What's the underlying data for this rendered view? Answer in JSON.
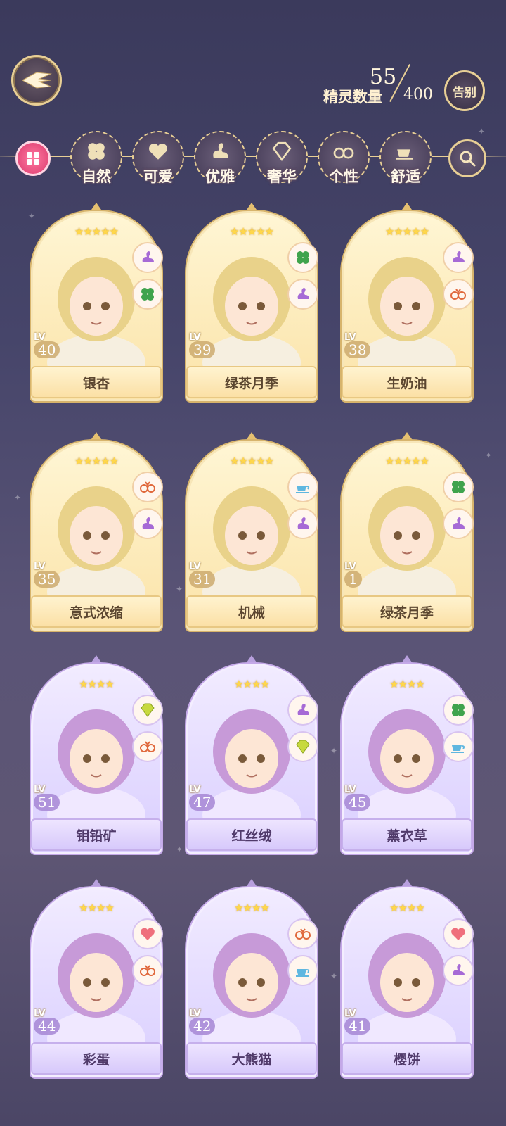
{
  "header": {
    "count_label": "精灵数量",
    "count_current": "55",
    "count_max": "400",
    "farewell_label": "告别"
  },
  "filters": [
    {
      "label": "自然",
      "icon": "clover-icon"
    },
    {
      "label": "可爱",
      "icon": "heart-icon"
    },
    {
      "label": "优雅",
      "icon": "swan-icon"
    },
    {
      "label": "奢华",
      "icon": "diamond-icon"
    },
    {
      "label": "个性",
      "icon": "glasses-icon"
    },
    {
      "label": "舒适",
      "icon": "teacup-icon"
    }
  ],
  "cards": [
    {
      "name": "银杏",
      "level": "40",
      "stars": "★★★★★",
      "rarity": "gold",
      "tags": [
        "swan-icon",
        "clover-icon"
      ]
    },
    {
      "name": "绿茶月季",
      "level": "39",
      "stars": "★★★★★",
      "rarity": "gold",
      "tags": [
        "clover-icon",
        "swan-icon"
      ]
    },
    {
      "name": "生奶油",
      "level": "38",
      "stars": "★★★★★",
      "rarity": "gold",
      "tags": [
        "swan-icon",
        "glasses-icon"
      ]
    },
    {
      "name": "意式浓缩",
      "level": "35",
      "stars": "★★★★★",
      "rarity": "gold",
      "tags": [
        "glasses-icon",
        "swan-icon"
      ]
    },
    {
      "name": "机械",
      "level": "31",
      "stars": "★★★★★",
      "rarity": "gold",
      "tags": [
        "teacup-icon",
        "swan-icon"
      ]
    },
    {
      "name": "绿茶月季",
      "level": "1",
      "stars": "★★★★★",
      "rarity": "gold",
      "tags": [
        "clover-icon",
        "swan-icon"
      ]
    },
    {
      "name": "钼铅矿",
      "level": "51",
      "stars": "★★★★",
      "rarity": "purple",
      "tags": [
        "diamond-icon",
        "glasses-icon"
      ]
    },
    {
      "name": "红丝绒",
      "level": "47",
      "stars": "★★★★",
      "rarity": "purple",
      "tags": [
        "swan-icon",
        "diamond-icon"
      ]
    },
    {
      "name": "薰衣草",
      "level": "45",
      "stars": "★★★★",
      "rarity": "purple",
      "tags": [
        "clover-icon",
        "teacup-icon"
      ]
    },
    {
      "name": "彩蛋",
      "level": "44",
      "stars": "★★★★",
      "rarity": "purple",
      "tags": [
        "heart-icon",
        "glasses-icon"
      ]
    },
    {
      "name": "大熊猫",
      "level": "42",
      "stars": "★★★★",
      "rarity": "purple",
      "tags": [
        "glasses-icon",
        "teacup-icon"
      ]
    },
    {
      "name": "樱饼",
      "level": "41",
      "stars": "★★★★",
      "rarity": "purple",
      "tags": [
        "heart-icon",
        "swan-icon"
      ]
    }
  ],
  "lv_label": "LV",
  "colors": {
    "gold_frame": "#d7b46c",
    "purple_frame": "#c4a8e8",
    "accent_pink": "#e44a7b"
  }
}
